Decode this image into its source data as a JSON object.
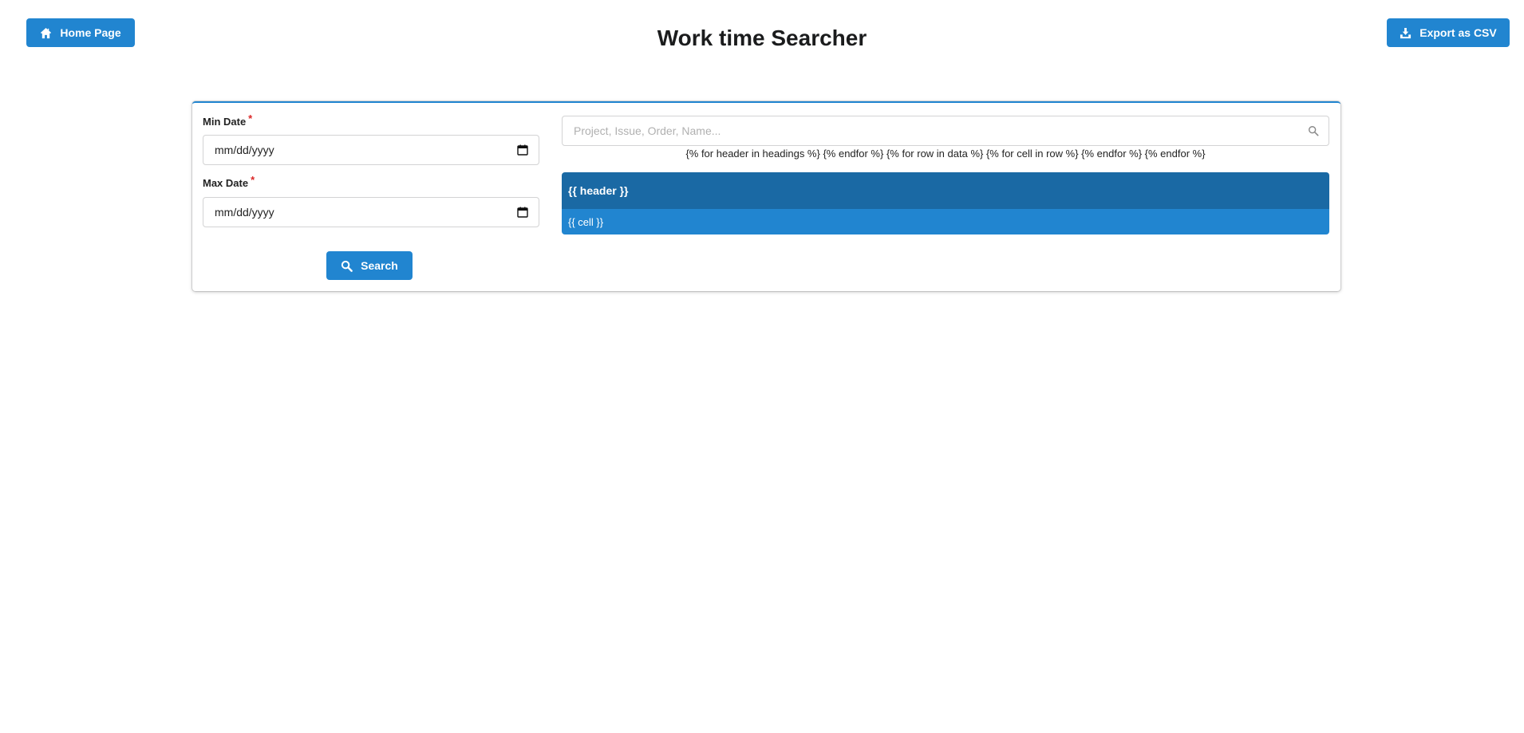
{
  "header": {
    "home_label": "Home Page",
    "title": "Work time Searcher",
    "export_label": "Export as CSV"
  },
  "filters": {
    "min_label": "Min Date",
    "min_required": "*",
    "min_value": "mm/dd/yyyy",
    "max_label": "Max Date",
    "max_required": "*",
    "max_value": "mm/dd/yyyy",
    "search_label": "Search"
  },
  "search": {
    "placeholder": "Project, Issue, Order, Name..."
  },
  "template_text": "{% for header in headings %} {% endfor %} {% for row in data %} {% for cell in row %} {% endfor %} {% endfor %}",
  "table": {
    "header": "{{ header }}",
    "cell": "{{ cell }}"
  },
  "colors": {
    "primary": "#2185d0",
    "header_dark": "#1a69a4",
    "required": "#db2828"
  },
  "icons": {
    "home": "home-icon",
    "export": "download-icon",
    "search": "search-icon",
    "calendar": "calendar-icon"
  }
}
